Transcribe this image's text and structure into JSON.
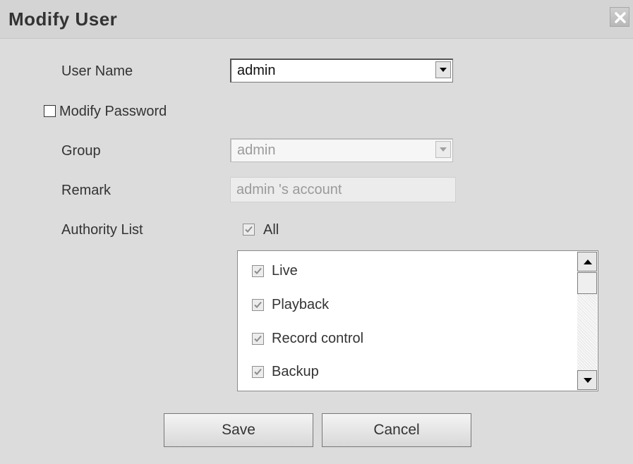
{
  "dialog": {
    "title": "Modify User"
  },
  "form": {
    "user_name_label": "User Name",
    "user_name_value": "admin",
    "modify_password_label": "Modify Password",
    "modify_password_checked": false,
    "group_label": "Group",
    "group_value": "admin",
    "remark_label": "Remark",
    "remark_value": "admin 's account",
    "authority_label": "Authority List",
    "all_label": "All",
    "all_checked": true
  },
  "authority_items": [
    {
      "label": "Live",
      "checked": true
    },
    {
      "label": "Playback",
      "checked": true
    },
    {
      "label": "Record control",
      "checked": true
    },
    {
      "label": "Backup",
      "checked": true
    }
  ],
  "buttons": {
    "save_label": "Save",
    "cancel_label": "Cancel"
  },
  "icons": {
    "close": "close-icon",
    "dropdown": "chevron-down-icon",
    "scroll_up": "arrow-up-icon",
    "scroll_down": "arrow-down-icon",
    "check": "check-icon"
  }
}
